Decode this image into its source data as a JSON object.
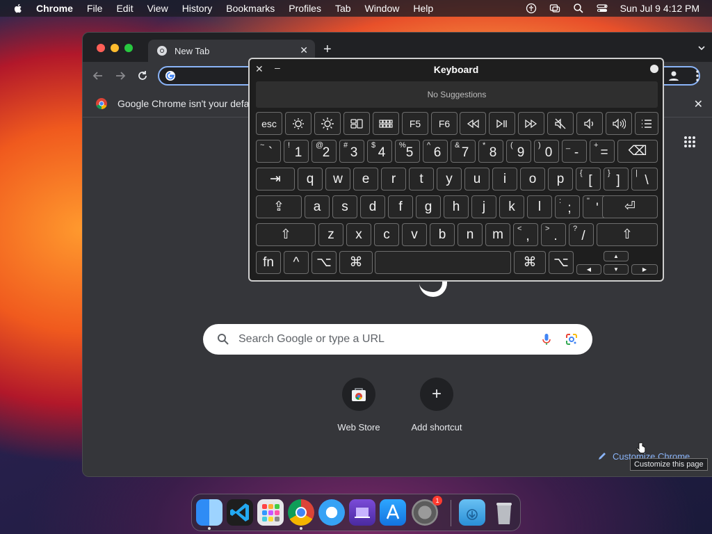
{
  "menubar": {
    "app_name": "Chrome",
    "items": [
      "File",
      "Edit",
      "View",
      "History",
      "Bookmarks",
      "Profiles",
      "Tab",
      "Window",
      "Help"
    ],
    "clock": "Sun Jul 9  4:12 PM"
  },
  "browser": {
    "tab_title": "New Tab",
    "new_tab_glyph": "+",
    "tab_close_glyph": "✕",
    "infobar_text": "Google Chrome isn't your defa",
    "infobar_close_glyph": "✕",
    "search_placeholder": "Search Google or type a URL",
    "shortcuts": [
      {
        "label": "Web Store",
        "icon": "webstore-icon"
      },
      {
        "label": "Add shortcut",
        "icon": "plus-icon",
        "glyph": "+"
      }
    ],
    "customize_label": "Customize Chrome",
    "tooltip": "Customize this page"
  },
  "keyboard": {
    "title": "Keyboard",
    "close_glyph": "✕",
    "min_glyph": "–",
    "suggestions": "No Suggestions",
    "fn_row": {
      "esc": "esc",
      "f5": "F5",
      "f6": "F6"
    },
    "number_row": [
      {
        "sup": "~",
        "main": "`"
      },
      {
        "sup": "!",
        "main": "1"
      },
      {
        "sup": "@",
        "main": "2"
      },
      {
        "sup": "#",
        "main": "3"
      },
      {
        "sup": "$",
        "main": "4"
      },
      {
        "sup": "%",
        "main": "5"
      },
      {
        "sup": "^",
        "main": "6"
      },
      {
        "sup": "&",
        "main": "7"
      },
      {
        "sup": "*",
        "main": "8"
      },
      {
        "sup": "(",
        "main": "9"
      },
      {
        "sup": ")",
        "main": "0"
      },
      {
        "sup": "_",
        "main": "-"
      },
      {
        "sup": "+",
        "main": "="
      }
    ],
    "row_q": [
      "q",
      "w",
      "e",
      "r",
      "t",
      "y",
      "u",
      "i",
      "o",
      "p"
    ],
    "row_q_punct": [
      {
        "sup": "{",
        "main": "["
      },
      {
        "sup": "}",
        "main": "]"
      },
      {
        "sup": "|",
        "main": "\\"
      }
    ],
    "row_a": [
      "a",
      "s",
      "d",
      "f",
      "g",
      "h",
      "j",
      "k",
      "l"
    ],
    "row_a_punct": [
      {
        "sup": ":",
        "main": ";"
      },
      {
        "sup": "\"",
        "main": "'"
      }
    ],
    "row_z": [
      "z",
      "x",
      "c",
      "v",
      "b",
      "n",
      "m"
    ],
    "row_z_punct": [
      {
        "sup": "<",
        "main": ","
      },
      {
        "sup": ">",
        "main": "."
      },
      {
        "sup": "?",
        "main": "/"
      }
    ],
    "bottom": {
      "fn": "fn",
      "control": "^",
      "option": "⌥",
      "command": "⌘",
      "tab": "⇥",
      "delete": "⌫",
      "caps": "⇪",
      "return": "⏎",
      "shift": "⇧",
      "arrow_up": "▲",
      "arrow_down": "▼",
      "arrow_left": "◀",
      "arrow_right": "▶"
    }
  },
  "dock": {
    "badge": "1"
  }
}
